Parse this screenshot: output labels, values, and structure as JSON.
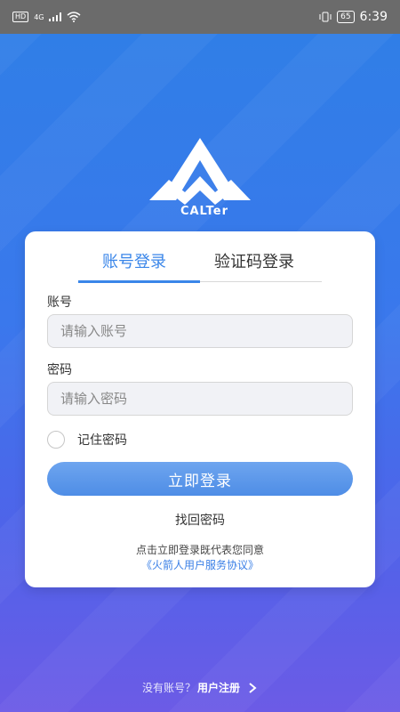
{
  "status_bar": {
    "hd": "HD",
    "network": "4G",
    "battery": "65",
    "time": "6:39"
  },
  "logo": {
    "text": "CALTer"
  },
  "tabs": [
    {
      "label": "账号登录",
      "active": true
    },
    {
      "label": "验证码登录",
      "active": false
    }
  ],
  "account": {
    "label": "账号",
    "placeholder": "请输入账号",
    "value": ""
  },
  "password": {
    "label": "密码",
    "placeholder": "请输入密码",
    "value": ""
  },
  "remember": {
    "label": "记住密码",
    "checked": false
  },
  "login_button": "立即登录",
  "forgot_password": "找回密码",
  "agreement": {
    "text": "点击立即登录既代表您同意",
    "link": "《火箭人用户服务协议》"
  },
  "footer": {
    "question": "没有账号？",
    "register": "用户注册"
  },
  "colors": {
    "accent": "#3a86e9",
    "background_top": "#2f7fe6",
    "background_bottom": "#6c5be6"
  }
}
